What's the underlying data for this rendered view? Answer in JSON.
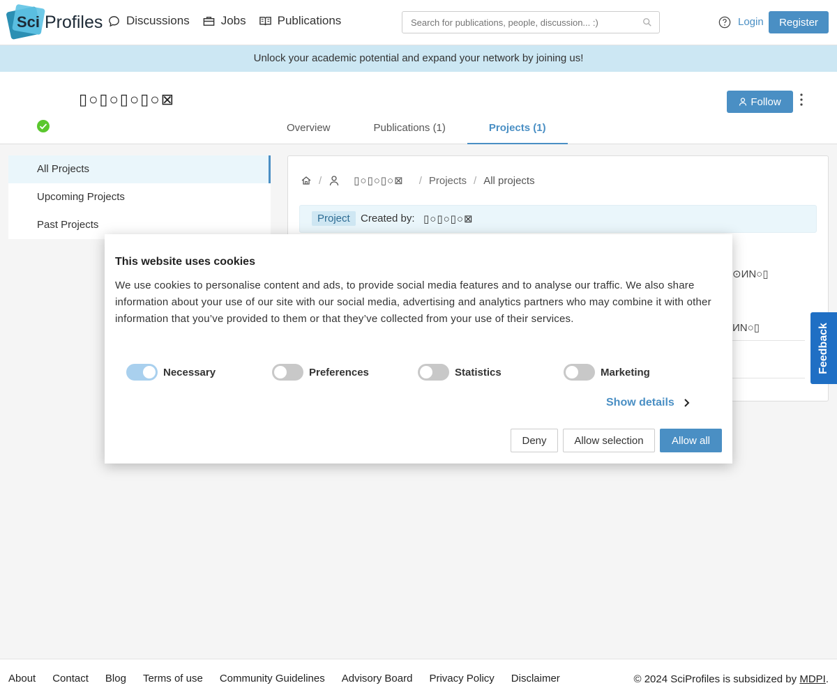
{
  "header": {
    "logo_sci": "Sci",
    "logo_text": "Profiles",
    "nav": [
      {
        "label": "Discussions",
        "icon": "chat-icon"
      },
      {
        "label": "Jobs",
        "icon": "briefcase-icon"
      },
      {
        "label": "Publications",
        "icon": "book-icon"
      }
    ],
    "search_placeholder": "Search for publications, people, discussion... :)",
    "login": "Login",
    "register": "Register"
  },
  "banner": "Unlock your academic potential and expand your network by joining us!",
  "profile": {
    "name": "▯○▯○▯○▯○⊠",
    "follow": "Follow",
    "tabs": [
      {
        "label": "Overview",
        "active": false
      },
      {
        "label": "Publications (1)",
        "active": false
      },
      {
        "label": "Projects (1)",
        "active": true
      }
    ]
  },
  "sidebar": {
    "items": [
      {
        "label": "All Projects",
        "active": true
      },
      {
        "label": "Upcoming Projects",
        "active": false
      },
      {
        "label": "Past Projects",
        "active": false
      }
    ]
  },
  "content": {
    "breadcrumb": {
      "name": "▯○▯○▯○⊠",
      "projects": "Projects",
      "all": "All projects"
    },
    "project_tag": "Project",
    "created_by": "Created by:",
    "created_name": "▯○▯○▯○⊠",
    "frag1": "⊙ИN○▯",
    "frag2": "ИN○▯"
  },
  "feedback": "Feedback",
  "cookie": {
    "title": "This website uses cookies",
    "body": "We use cookies to personalise content and ads, to provide social media features and to analyse our traffic. We also share information about your use of our site with our social media, advertising and analytics partners who may combine it with other information that you’ve provided to them or that they’ve collected from your use of their services.",
    "toggles": [
      {
        "label": "Necessary",
        "on": true
      },
      {
        "label": "Preferences",
        "on": false
      },
      {
        "label": "Statistics",
        "on": false
      },
      {
        "label": "Marketing",
        "on": false
      }
    ],
    "show_details": "Show details",
    "deny": "Deny",
    "allow_selection": "Allow selection",
    "allow_all": "Allow all"
  },
  "footer": {
    "links": [
      "About",
      "Contact",
      "Blog",
      "Terms of use",
      "Community Guidelines",
      "Advisory Board",
      "Privacy Policy",
      "Disclaimer"
    ],
    "copyright_prefix": "© 2024 SciProfiles is subsidized by ",
    "copyright_link": "MDPI",
    "copyright_suffix": "."
  },
  "colors": {
    "accent": "#4a8fc4",
    "banner": "#cce7f3",
    "feedback": "#1f6fc4",
    "verified": "#5ac72e"
  }
}
